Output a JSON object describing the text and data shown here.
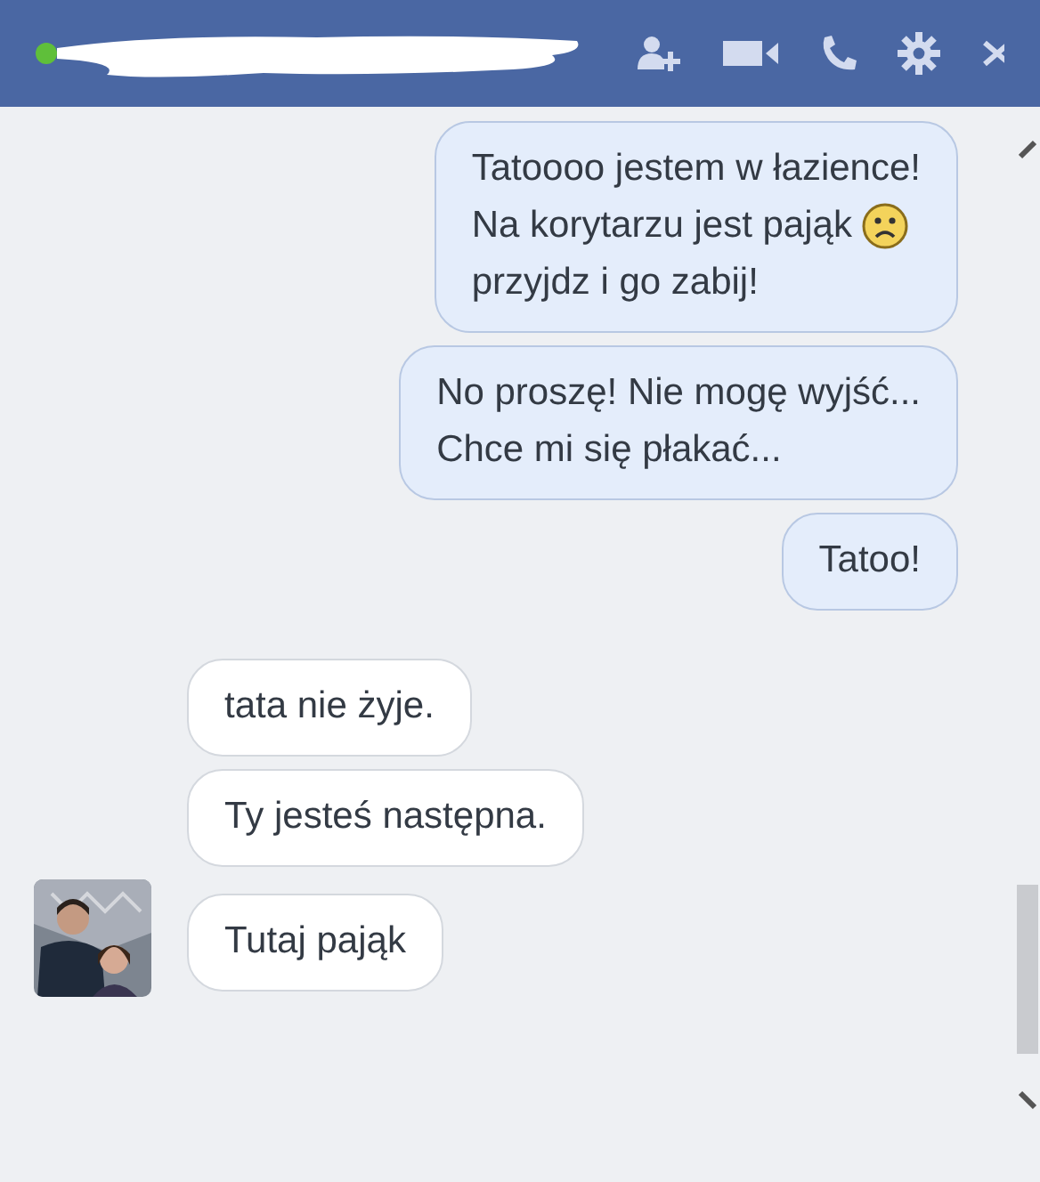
{
  "header": {
    "online": true,
    "name_redacted": true
  },
  "messages": [
    {
      "kind": "sent",
      "lines": [
        {
          "text": "Tatoooo jestem w łazience!"
        },
        {
          "text": "Na korytarzu jest pająk",
          "sad_face": true
        },
        {
          "text": "przyjdz i go zabij!"
        }
      ]
    },
    {
      "kind": "sent",
      "lines": [
        {
          "text": "No proszę! Nie mogę wyjść..."
        },
        {
          "text": "Chce mi się płakać..."
        }
      ]
    },
    {
      "kind": "sent",
      "lines": [
        {
          "text": "Tatoo!"
        }
      ]
    },
    {
      "kind": "received",
      "avatar": false,
      "lines": [
        {
          "text": "tata nie żyje."
        }
      ]
    },
    {
      "kind": "received",
      "avatar": false,
      "lines": [
        {
          "text": "Ty jesteś następna."
        }
      ]
    },
    {
      "kind": "received",
      "avatar": true,
      "lines": [
        {
          "text": "Tutaj pająk"
        }
      ]
    }
  ]
}
